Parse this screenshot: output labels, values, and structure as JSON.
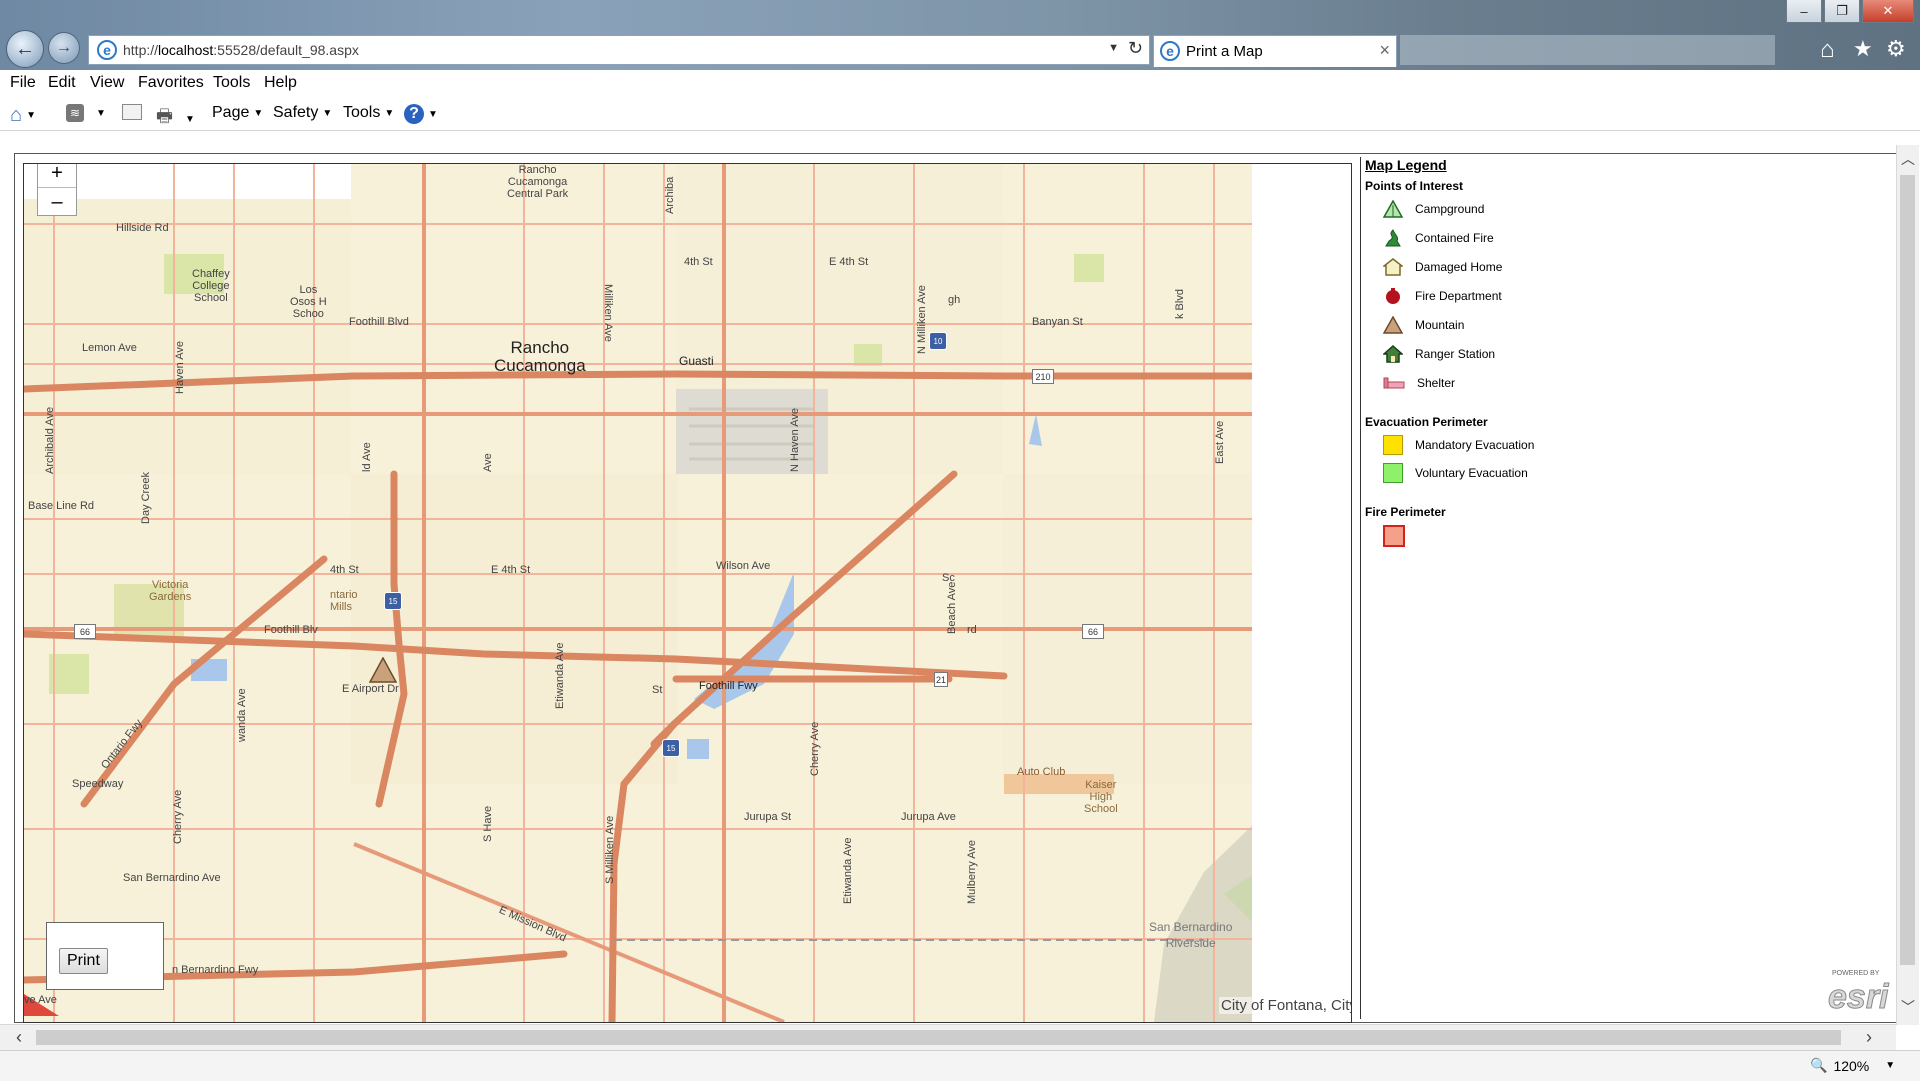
{
  "browser": {
    "url_prefix": "http://",
    "url_host": "localhost",
    "url_rest": ":55528/default_98.aspx",
    "tab_title": "Print a Map",
    "tab_close": "×",
    "window_controls": {
      "minimize": "–",
      "maximize": "❐",
      "close": "✕"
    },
    "menu": [
      "File",
      "Edit",
      "View",
      "Favorites",
      "Tools",
      "Help"
    ],
    "commands": {
      "page": "Page",
      "safety": "Safety",
      "tools": "Tools",
      "help": "?"
    },
    "zoom": "120%"
  },
  "map": {
    "zoom_in": "+",
    "zoom_out": "–",
    "print_button": "Print",
    "attribution": "City of Fontana, City of Rancho Cucamonga, Bureau of Land Management, Esri, HE...",
    "esri_powered": "POWERED BY",
    "esri_logo": "esri",
    "labels": {
      "rancho_central_park": "Rancho\nCucamonga\nCentral Park",
      "hillside": "Hillside Rd",
      "chaffey": "Chaffey\nCollege\nSchool",
      "los_osos": "Los\nOsos H\nSchoo",
      "foothill_blvd_top": "Foothill Blvd",
      "lemon": "Lemon Ave",
      "city_rancho": "Rancho\nCucamonga",
      "guasti": "Guasti",
      "fourth_st_top": "4th St",
      "e_fourth_st_top": "E 4th St",
      "banyan": "Banyan St",
      "archibald": "Archibald Ave",
      "haven": "Haven Ave",
      "n_haven": "N Haven Ave",
      "n_milliken": "N Milliken Ave",
      "milliken": "Milliken Ave",
      "archiba": "Archiba",
      "base_line": "Base Line Rd",
      "day_creek": "Day Creek",
      "victoria": "Victoria\nGardens",
      "fourth_st_mid": "4th St",
      "ontario_mills": "ntario\nMills",
      "e_fourth_st_mid": "E 4th St",
      "foothill_blv_mid": "Foothill Blv",
      "ontario_fwy": "Ontario Fwy",
      "etiwanda": "Etiwanda Ave",
      "e_airport": "E Airport Dr",
      "wilson": "Wilson Ave",
      "foothill_fwy": "Foothill Fwy",
      "beach": "Beach Ave",
      "cherry_mid": "Cherry Ave",
      "auto_club": "Auto Club",
      "kaiser": "Kaiser\nHigh\nSchool",
      "speedway": "Speedway",
      "san_bernardino_ave": "San Bernardino Ave",
      "cherry_low": "Cherry Ave",
      "s_milliken": "S Milliken Ave",
      "jurupa_st": "Jurupa St",
      "jurupa_ave": "Jurupa Ave",
      "etiwanda_low": "Etiwanda Ave",
      "mulberry": "Mulberry Ave",
      "e_mission": "E Mission Blvd",
      "san_bernardino_fwy": "n Bernardino Fwy",
      "san_bernardino_riverside": "San Bernardino\nRiverside",
      "wanda": "wanda Ave",
      "east_ave": "East Ave",
      "rd_frag": "rd",
      "ba_frag": "Ba",
      "ve_frag": "ve Ave",
      "s_have": "S Have",
      "ld_ave": "ld Ave",
      "ave_frag": "Ave",
      "gh_frag": "gh",
      "sc_frag": "Sc",
      "k_blvd": "k Blvd",
      "st_frag": "St"
    },
    "shields": {
      "i10": "10",
      "i15_top": "15",
      "i15_bottom": "15",
      "r210": "210",
      "r66_left": "66",
      "r66_right": "66",
      "r21": "21"
    }
  },
  "legend": {
    "title": "Map Legend",
    "sections": [
      {
        "heading": "Points of Interest",
        "items": [
          {
            "label": "Campground",
            "icon": "campground-icon"
          },
          {
            "label": "Contained Fire",
            "icon": "contained-fire-icon"
          },
          {
            "label": "Damaged Home",
            "icon": "damaged-home-icon"
          },
          {
            "label": "Fire Department",
            "icon": "fire-department-icon"
          },
          {
            "label": "Mountain",
            "icon": "mountain-icon"
          },
          {
            "label": "Ranger Station",
            "icon": "ranger-station-icon"
          },
          {
            "label": "Shelter",
            "icon": "shelter-icon"
          }
        ]
      },
      {
        "heading": "Evacuation Perimeter",
        "items": [
          {
            "label": "Mandatory Evacuation",
            "color": "#ffe100"
          },
          {
            "label": "Voluntary Evacuation",
            "color": "#8ef06b"
          }
        ]
      },
      {
        "heading": "Fire Perimeter",
        "items": [
          {
            "label": "",
            "color": "#f5a08a"
          }
        ]
      }
    ]
  },
  "colors": {
    "map_base": "#f7f1d9",
    "road_major": "#e79a79",
    "road_minor": "#f3b49c",
    "water": "#a9c7ea",
    "park": "#d9e6a8"
  }
}
